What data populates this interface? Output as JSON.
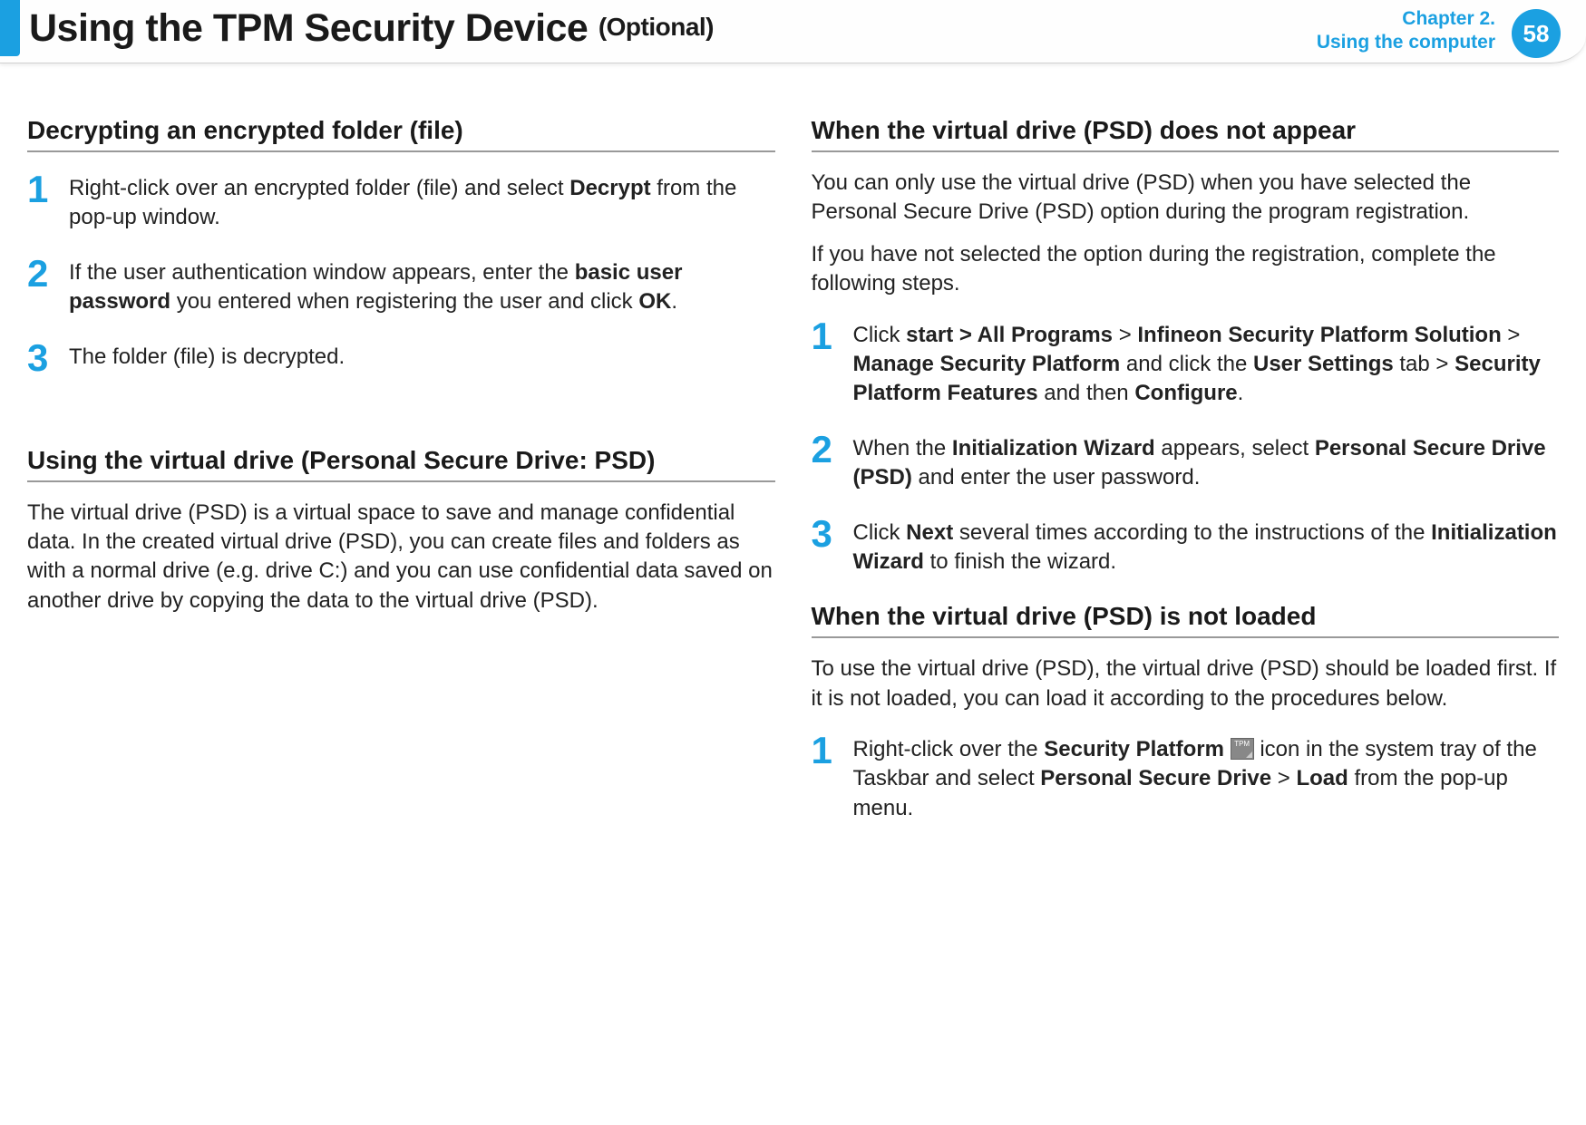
{
  "header": {
    "title_main": "Using the TPM Security Device",
    "title_suffix": "(Optional)",
    "chapter_line1": "Chapter 2.",
    "chapter_line2": "Using the computer",
    "page_number": "58"
  },
  "left": {
    "section1_title": "Decrypting an encrypted folder (file)",
    "steps1": {
      "1": {
        "pre": "Right-click over an encrypted folder (file) and select ",
        "b1": "Decrypt",
        "post": " from the pop-up window."
      },
      "2": {
        "pre": "If the user authentication window appears, enter the ",
        "b1": "basic user password",
        "mid": " you entered when registering the user and click ",
        "b2": "OK",
        "post": "."
      },
      "3": {
        "text": "The folder (file) is decrypted."
      }
    },
    "section2_title": "Using the virtual drive (Personal Secure Drive: PSD)",
    "section2_para": "The virtual drive (PSD) is a virtual space to save and manage confidential data. In the created virtual drive (PSD), you can create files and folders as with a normal drive (e.g. drive C:) and you can use confidential data saved on another drive by copying the data to the virtual drive (PSD)."
  },
  "right": {
    "section1_title": "When the virtual drive (PSD) does not appear",
    "section1_para1": "You can only use the virtual drive (PSD) when you have selected the Personal Secure Drive (PSD) option during the program registration.",
    "section1_para2": " If you have not selected the option during the registration, complete the following steps.",
    "steps1": {
      "1": {
        "pre": "Click ",
        "b1": "start > All Programs",
        "mid1": " > ",
        "b2": "Infineon Security Platform Solution",
        "mid2": " > ",
        "b3": "Manage Security Platform",
        "mid3": " and click the ",
        "b4": "User Settings",
        "mid4": " tab > ",
        "b5": "Security Platform Features",
        "mid5": " and then ",
        "b6": "Configure",
        "post": "."
      },
      "2": {
        "pre": "When the ",
        "b1": "Initialization Wizard",
        "mid": " appears, select ",
        "b2": "Personal Secure Drive (PSD)",
        "post": " and enter the user password."
      },
      "3": {
        "pre": "Click ",
        "b1": "Next",
        "mid": " several times according to the instructions of the ",
        "b2": "Initialization Wizard",
        "post": " to finish the wizard."
      }
    },
    "section2_title": "When the virtual drive (PSD) is not loaded",
    "section2_para": "To use the virtual drive (PSD), the virtual drive (PSD) should be loaded first. If it is not loaded, you can load it according to the procedures below.",
    "steps2": {
      "1": {
        "pre": "Right-click over the ",
        "b1": "Security Platform",
        "mid1": " ",
        "iconlabel": "TPM",
        "mid2": " icon in the system tray of the Taskbar and select ",
        "b2": "Personal Secure Drive",
        "mid3": " > ",
        "b3": "Load",
        "post": " from the pop-up menu."
      }
    }
  }
}
